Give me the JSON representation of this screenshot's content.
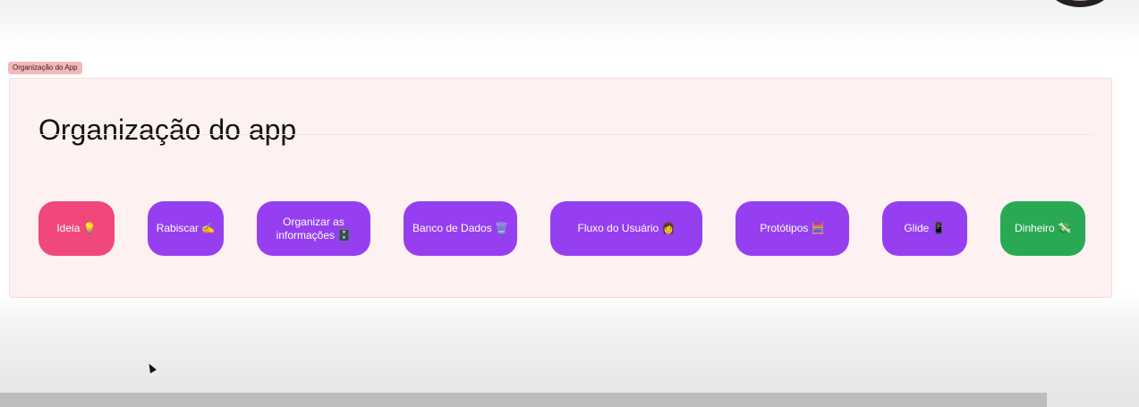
{
  "section": {
    "tag_label": "Organização do App",
    "title": "Organização do app"
  },
  "pills": [
    {
      "label": "Ideia 💡",
      "color": "#f0487a"
    },
    {
      "label": "Rabiscar ✍️",
      "color": "#953ff0"
    },
    {
      "label": "Organizar as informações 🗄️",
      "color": "#953ff0"
    },
    {
      "label": "Banco de Dados 🗑️",
      "color": "#953ff0"
    },
    {
      "label": "Fluxo do Usuário 👩",
      "color": "#953ff0"
    },
    {
      "label": "Protótipos 🧮",
      "color": "#953ff0"
    },
    {
      "label": "Glide 📱",
      "color": "#953ff0"
    },
    {
      "label": "Dinheiro 💸",
      "color": "#2aa955"
    }
  ],
  "icons": {
    "avatar": "user-avatar",
    "cursor": "mouse-cursor-icon"
  }
}
